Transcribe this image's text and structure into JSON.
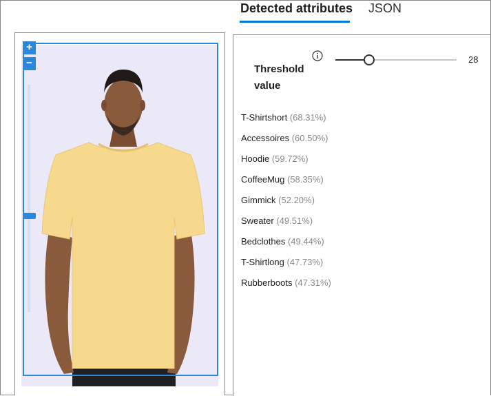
{
  "tabs": [
    {
      "label": "Detected attributes",
      "active": true
    },
    {
      "label": "JSON",
      "active": false
    }
  ],
  "image_viewer": {
    "zoom_in_label": "+",
    "zoom_out_label": "−",
    "zoom_level_fraction": 0.57,
    "image_description_icon": "man-in-yellow-tshirt-photo"
  },
  "threshold": {
    "label": "Threshold value",
    "info_icon": "info-icon",
    "value": 28,
    "min": 0,
    "max": 100,
    "value_text": "28"
  },
  "attributes": [
    {
      "name": "T-Shirtshort",
      "score": "(68.31%)"
    },
    {
      "name": "Accessoires",
      "score": "(60.50%)"
    },
    {
      "name": "Hoodie",
      "score": "(59.72%)"
    },
    {
      "name": "CoffeeMug",
      "score": "(58.35%)"
    },
    {
      "name": "Gimmick",
      "score": "(52.20%)"
    },
    {
      "name": "Sweater",
      "score": "(49.51%)"
    },
    {
      "name": "Bedclothes",
      "score": "(49.44%)"
    },
    {
      "name": "T-Shirtlong",
      "score": "(47.73%)"
    },
    {
      "name": "Rubberboots",
      "score": "(47.31%)"
    }
  ],
  "colors": {
    "accent": "#0078d4",
    "bbox": "#2b88d8",
    "shirt": "#f7d98e",
    "skin": "#8a5a3c"
  }
}
